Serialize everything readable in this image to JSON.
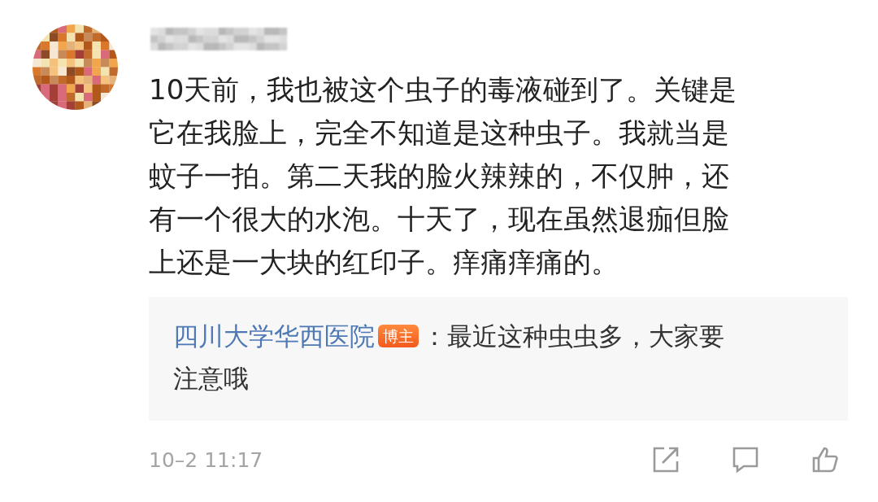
{
  "comment": {
    "text_lines": [
      "10天前，我也被这个虫子的毒液碰到了。关键是",
      "它在我脸上，完全不知道是这种虫子。我就当是",
      "蚊子一拍。第二天我的脸火辣辣的，不仅肿，还",
      "有一个很大的水泡。十天了，现在虽然退痂但脸",
      "上还是一大块的红印子。痒痛痒痛的。"
    ],
    "reply": {
      "author": "四川大学华西医院",
      "badge": "博主",
      "text_lines": [
        "：最近这种虫虫多，大家要",
        "注意哦"
      ]
    },
    "time": "10–2 11:17"
  }
}
